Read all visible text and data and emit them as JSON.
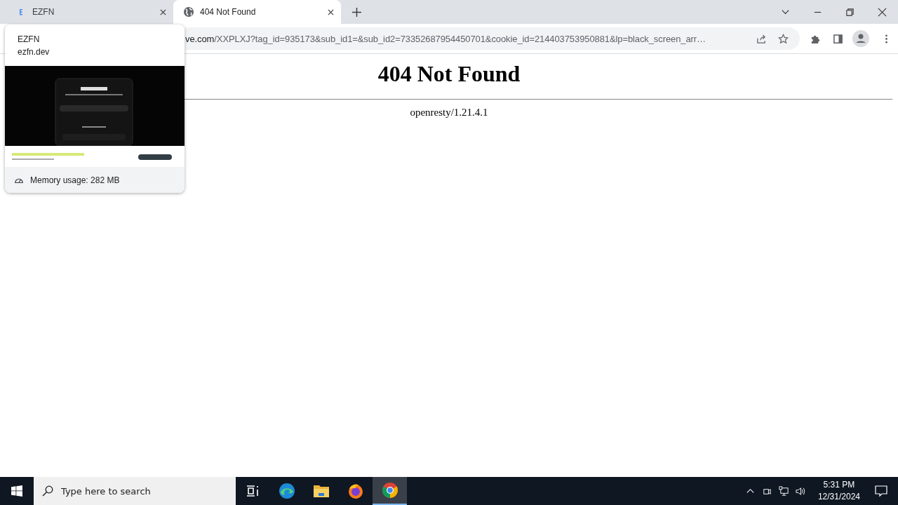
{
  "tabs": [
    {
      "title": "EZFN",
      "kind": "logo",
      "selected": false
    },
    {
      "title": "404 Not Found",
      "kind": "globe",
      "selected": true
    }
  ],
  "address_bar": {
    "url_host": "ve.com",
    "url_rest": "/XXPLXJ?tag_id=935173&sub_id1=&sub_id2=73352687954450701&cookie_id=214403753950881&lp=black_screen_arr…"
  },
  "tab_hover_card": {
    "title": "EZFN",
    "domain": "ezfn.dev",
    "memory": "Memory usage: 282 MB"
  },
  "page": {
    "heading": "404 Not Found",
    "footer": "openresty/1.21.4.1"
  },
  "taskbar": {
    "search_placeholder": "Type here to search",
    "time": "5:31 PM",
    "date": "12/31/2024",
    "apps": [
      {
        "kind": "task-view",
        "selected": false
      },
      {
        "kind": "edge",
        "selected": false
      },
      {
        "kind": "explorer",
        "selected": false
      },
      {
        "kind": "firefox",
        "selected": false
      },
      {
        "kind": "chrome",
        "selected": true
      }
    ]
  }
}
